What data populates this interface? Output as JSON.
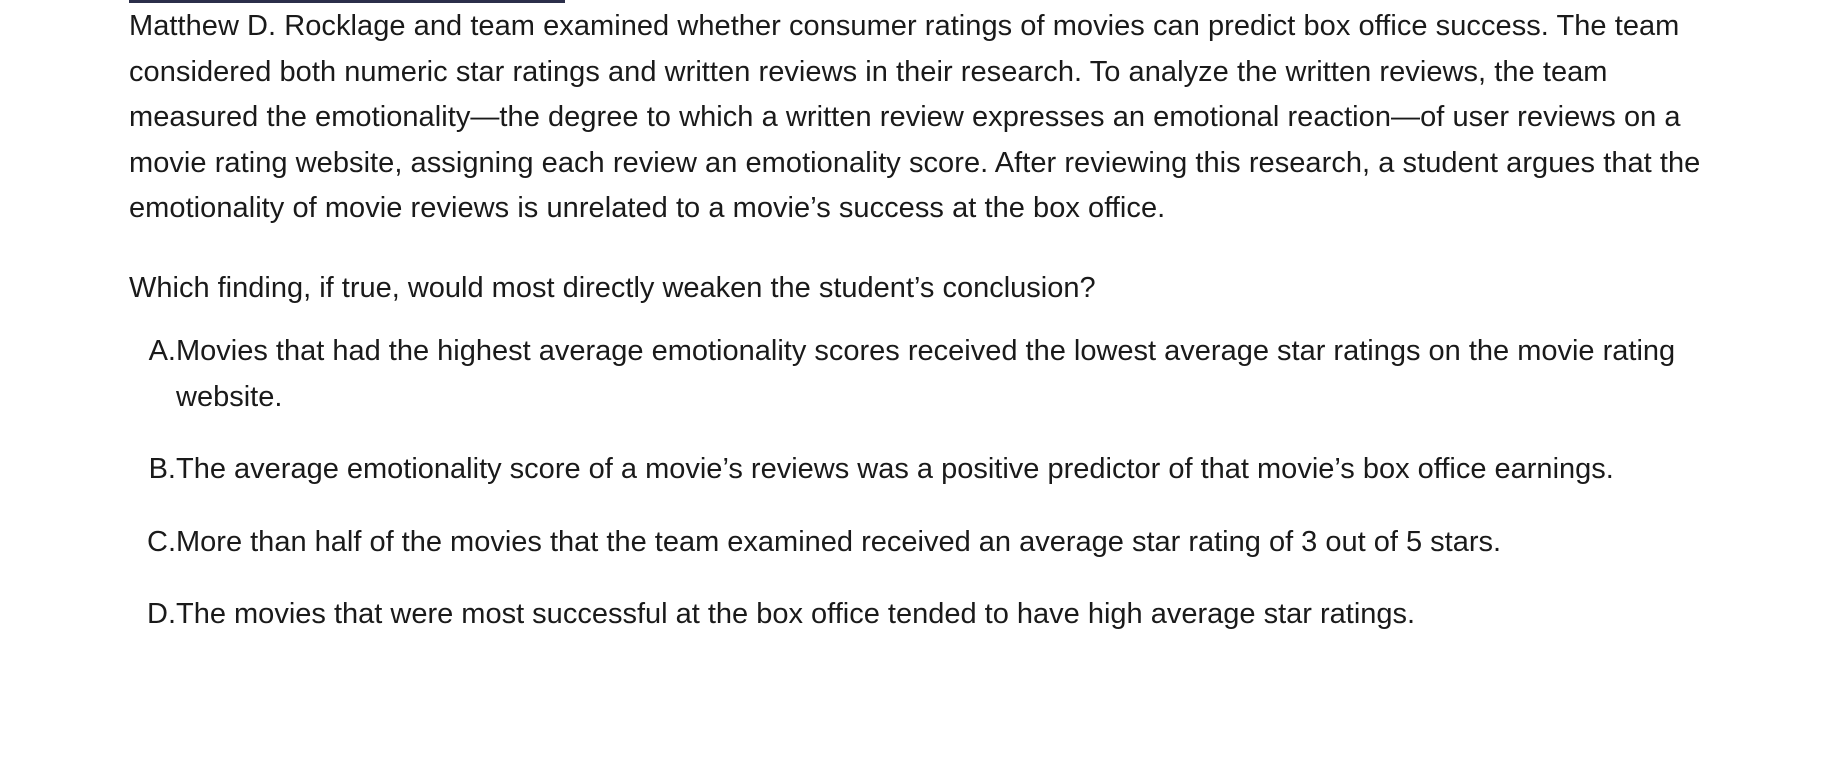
{
  "passage": "Matthew D. Rocklage and team examined whether consumer ratings of movies can predict box office success. The team considered both numeric star ratings and written reviews in their research. To analyze the written reviews, the team measured the emotionality—the degree to which a written review expresses an emotional reaction—of user reviews on a movie rating website, assigning each review an emotionality score. After reviewing this research, a student argues that the emotionality of movie reviews is unrelated to a movie’s success at the box office.",
  "question": "Which finding, if true, would most directly weaken the student’s conclusion?",
  "choices": [
    {
      "letter": "A.",
      "text": "Movies that had the highest average emotionality scores received the lowest average star ratings on the movie rating website."
    },
    {
      "letter": "B.",
      "text": "The average emotionality score of a movie’s reviews was a positive predictor of that movie’s box office earnings."
    },
    {
      "letter": "C.",
      "text": "More than half of the movies that the team examined received an average star rating of 3 out of 5 stars."
    },
    {
      "letter": "D.",
      "text": "The movies that were most successful at the box office tended to have high average star ratings."
    }
  ]
}
